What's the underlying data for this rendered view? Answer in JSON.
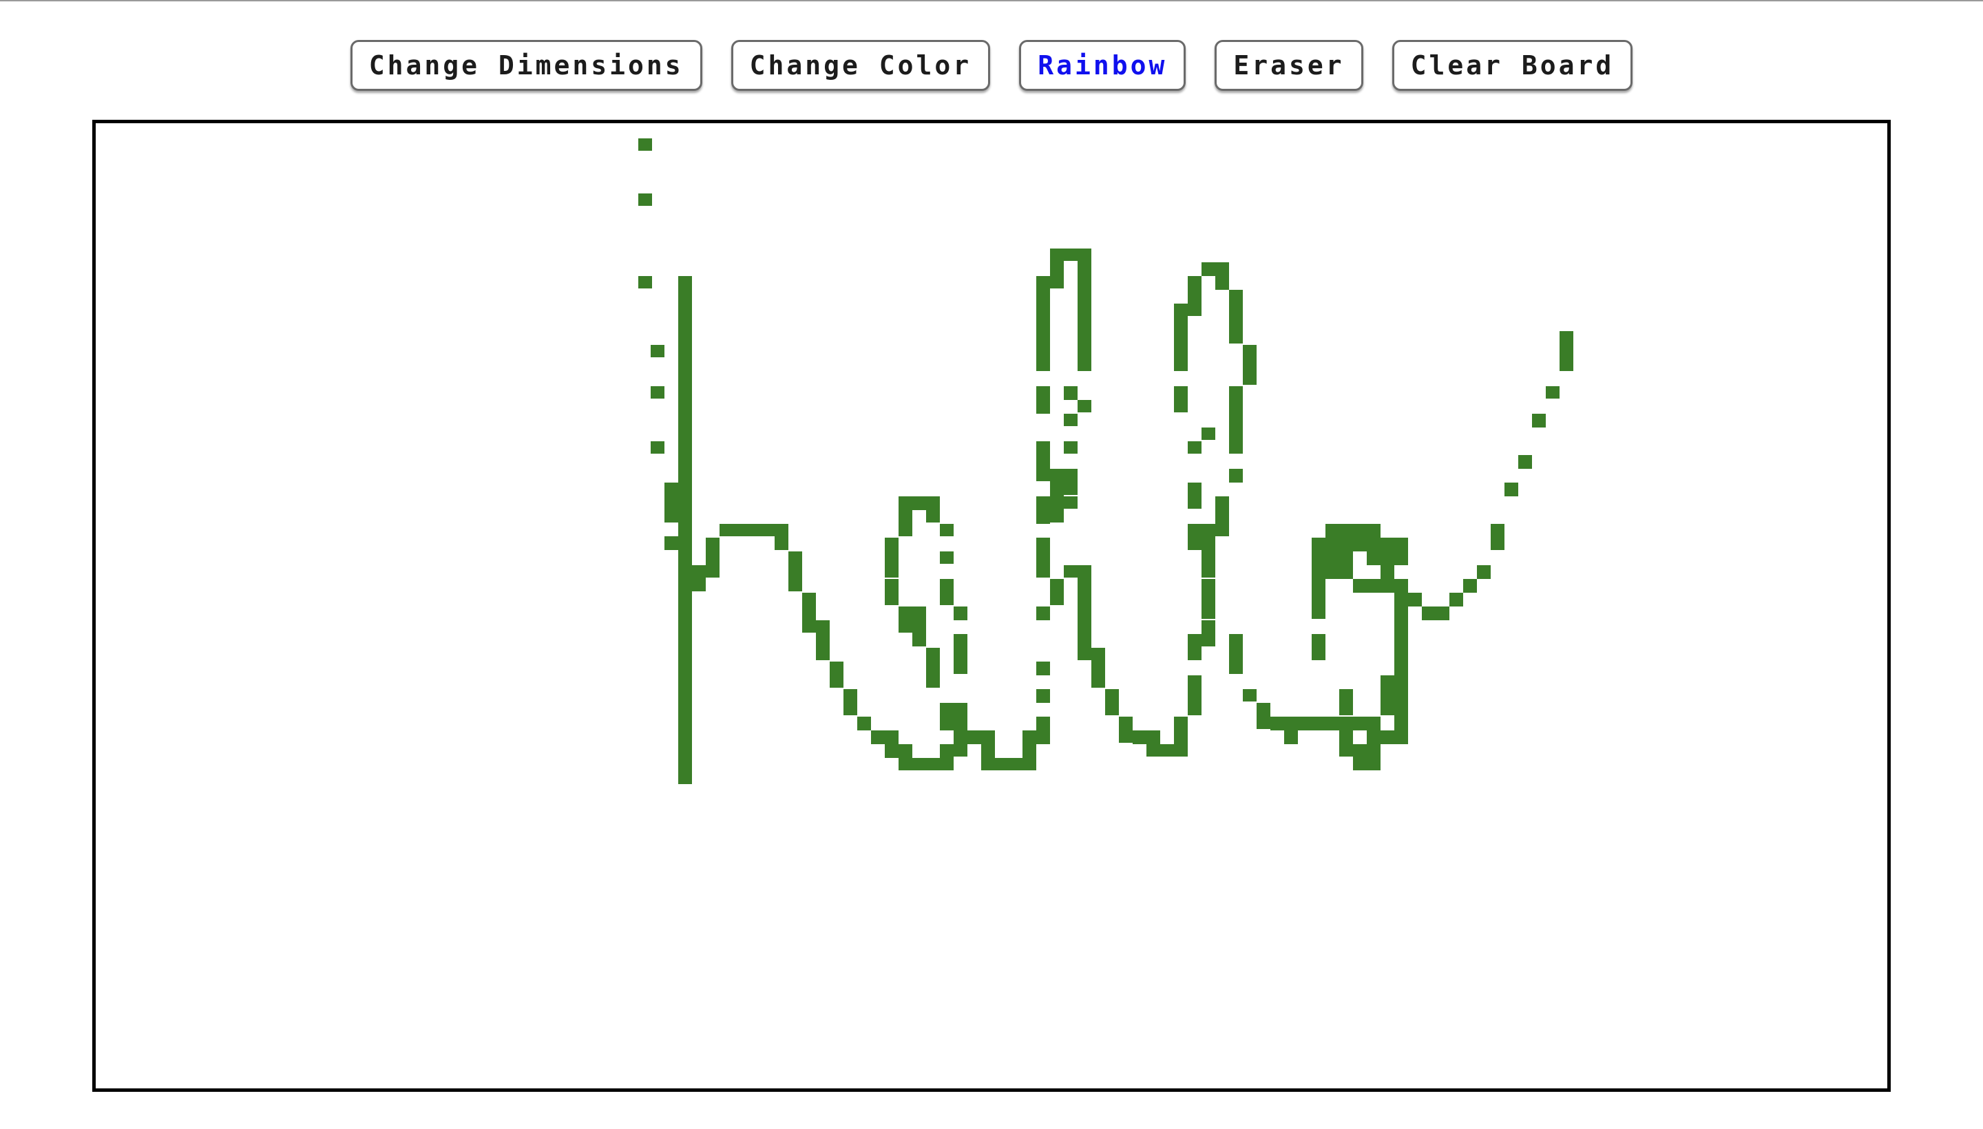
{
  "toolbar": {
    "buttons": [
      {
        "label": "Change Dimensions",
        "active": false
      },
      {
        "label": "Change Color",
        "active": false
      },
      {
        "label": "Rainbow",
        "active": true
      },
      {
        "label": "Eraser",
        "active": false
      },
      {
        "label": "Clear Board",
        "active": false
      }
    ],
    "active_color": "#1010ee"
  },
  "board": {
    "ink_color": "#3a7d27",
    "background": "#ffffff",
    "drawing_text": "hello"
  }
}
